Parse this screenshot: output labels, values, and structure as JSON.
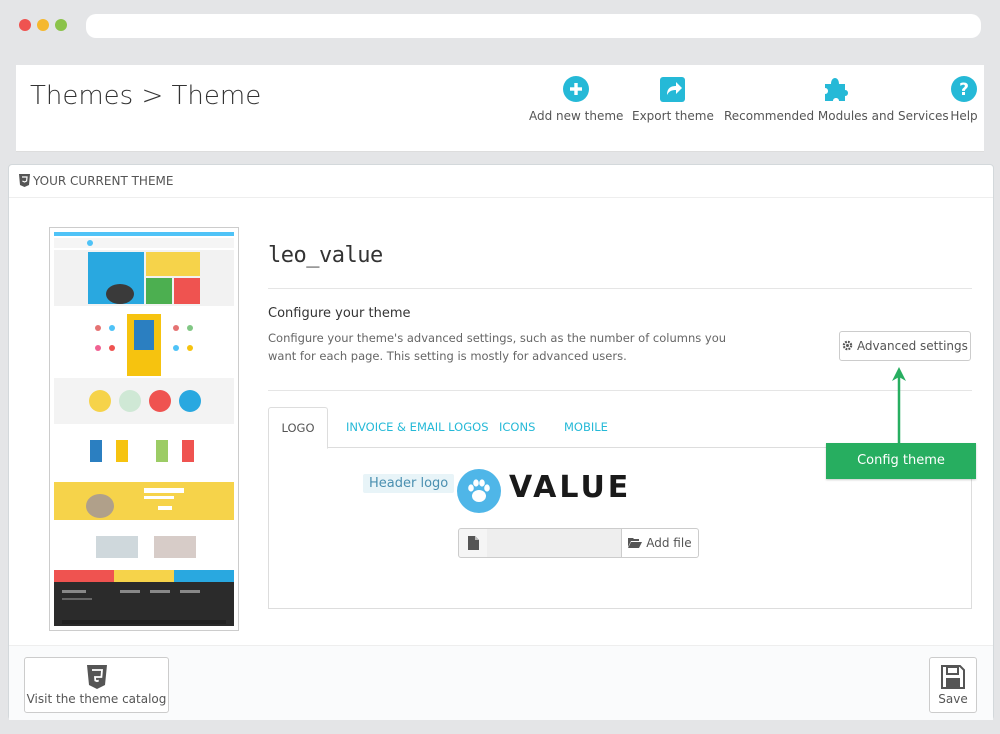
{
  "header": {
    "title": "Themes > Theme",
    "actions": [
      {
        "label": "Add new theme",
        "icon": "plus-circle-icon"
      },
      {
        "label": "Export theme",
        "icon": "export-icon"
      },
      {
        "label": "Recommended Modules and Services",
        "icon": "puzzle-icon"
      },
      {
        "label": "Help",
        "icon": "help-icon"
      }
    ]
  },
  "panel": {
    "heading": "YOUR CURRENT THEME",
    "theme_name": "leo_value",
    "configure_title": "Configure your theme",
    "configure_desc": "Configure your theme's advanced settings, such as the number of columns you want for each page. This setting is mostly for advanced users.",
    "advanced_button": "Advanced settings",
    "tabs": [
      "LOGO",
      "INVOICE & EMAIL LOGOS",
      "ICONS",
      "MOBILE"
    ],
    "active_tab": "LOGO",
    "header_logo_label": "Header logo",
    "brand_word": "VALUE",
    "add_file_label": "Add file",
    "callout": "Config theme",
    "footer": {
      "catalog_button": "Visit the theme catalog",
      "save_button": "Save"
    }
  },
  "colors": {
    "accent": "#25b9d7",
    "callout": "#27ae60"
  }
}
